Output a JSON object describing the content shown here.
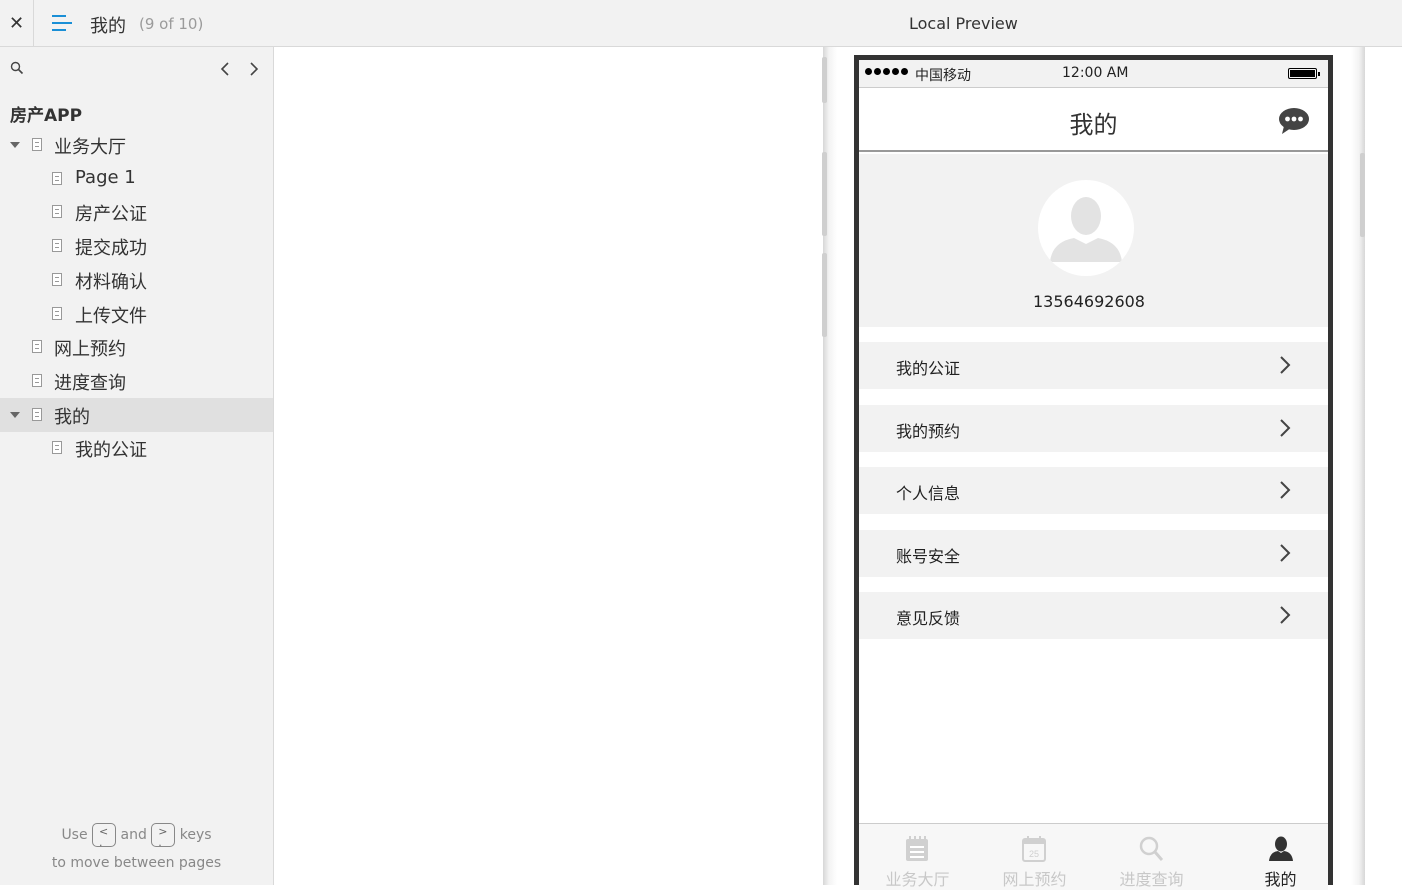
{
  "topbar": {
    "close": "✕",
    "page_title": "我的",
    "page_count": "(9 of 10)",
    "preview_title": "Local Preview"
  },
  "sidebar": {
    "nav_prev": "‹",
    "nav_next": "›",
    "project": "房产APP",
    "items": [
      {
        "label": "业务大厅",
        "level": 0,
        "expanded": true
      },
      {
        "label": "Page 1",
        "level": 1
      },
      {
        "label": "房产公证",
        "level": 1
      },
      {
        "label": "提交成功",
        "level": 1
      },
      {
        "label": "材料确认",
        "level": 1
      },
      {
        "label": "上传文件",
        "level": 1
      },
      {
        "label": "网上预约",
        "level": 0
      },
      {
        "label": "进度查询",
        "level": 0
      },
      {
        "label": "我的",
        "level": 0,
        "expanded": true,
        "active": true
      },
      {
        "label": "我的公证",
        "level": 1
      }
    ],
    "hint": {
      "use": "Use",
      "key_prev": "<\n.",
      "and": "and",
      "key_next": ">\n.",
      "keys": "keys",
      "line2": "to move between pages"
    }
  },
  "phone": {
    "status": {
      "carrier": "中国移动",
      "time": "12:00 AM"
    },
    "title": "我的",
    "phone_number": "13564692608",
    "menu": [
      "我的公证",
      "我的预约",
      "个人信息",
      "账号安全",
      "意见反馈"
    ],
    "tabs": [
      {
        "label": "业务大厅",
        "icon": "document-icon",
        "active": false
      },
      {
        "label": "网上预约",
        "icon": "calendar-icon",
        "active": false
      },
      {
        "label": "进度查询",
        "icon": "search-icon",
        "active": false
      },
      {
        "label": "我的",
        "icon": "user-icon",
        "active": true
      }
    ],
    "calendar_day": "25"
  },
  "colors": {
    "accent": "#1a8fd6",
    "sidebar_bg": "#f2f2f2",
    "active_row": "#e0e0e0"
  }
}
